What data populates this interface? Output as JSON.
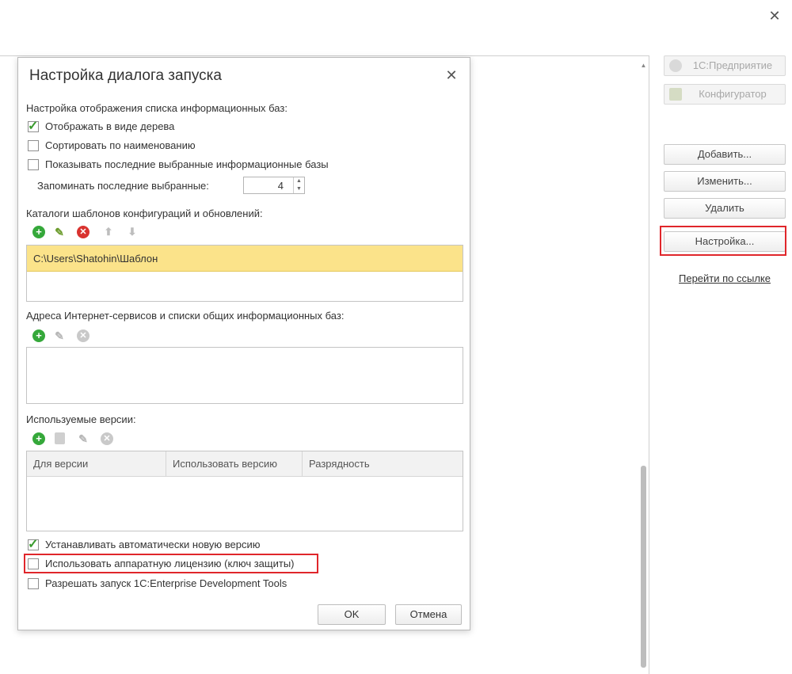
{
  "dialog": {
    "title": "Настройка диалога запуска",
    "section_display": "Настройка отображения списка информационных баз:",
    "cb_tree": "Отображать в виде дерева",
    "cb_sort": "Сортировать по наименованию",
    "cb_recent": "Показывать последние выбранные информационные базы",
    "remember_label": "Запоминать последние выбранные:",
    "remember_value": "4",
    "section_templates": "Каталоги шаблонов конфигураций и обновлений:",
    "template_path": "C:\\Users\\Shatohin\\Шаблон",
    "section_internet": "Адреса Интернет-сервисов и списки общих информационных баз:",
    "section_versions": "Используемые версии:",
    "columns": [
      "Для версии",
      "Использовать версию",
      "Разрядность"
    ],
    "cb_auto": "Устанавливать автоматически новую версию",
    "cb_hardware": "Использовать аппаратную лицензию (ключ защиты)",
    "cb_edt": "Разрешать запуск 1С:Enterprise Development Tools",
    "ok": "OK",
    "cancel": "Отмена"
  },
  "right_panel": {
    "enterprise": "1С:Предприятие",
    "configurator": "Конфигуратор",
    "add": "Добавить...",
    "edit": "Изменить...",
    "delete": "Удалить",
    "settings": "Настройка...",
    "link": "Перейти по ссылке"
  },
  "colors": {
    "highlight": "#e0262b",
    "selected_row": "#fbe38a",
    "check": "#3a9b2e"
  }
}
